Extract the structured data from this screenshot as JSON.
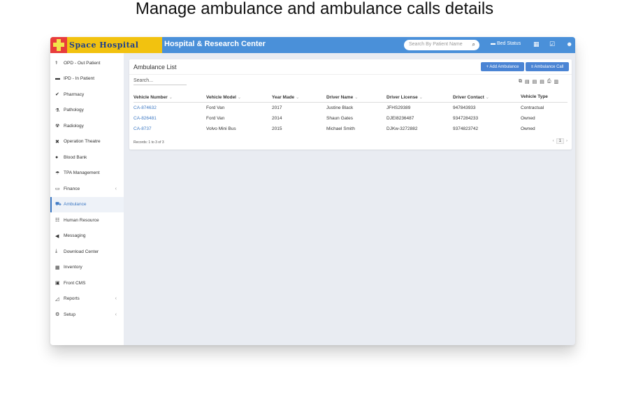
{
  "caption": "Manage ambulance and ambulance calls details",
  "header": {
    "logo_text": "Space Hospital",
    "site_title": "Hospital & Research Center",
    "search_placeholder": "Search By Patient Name",
    "bed_status": "Bed Status"
  },
  "sidebar": {
    "items": [
      {
        "label": "OPD - Out Patient",
        "icon": "stethoscope-icon"
      },
      {
        "label": "IPD - In Patient",
        "icon": "bed-icon"
      },
      {
        "label": "Pharmacy",
        "icon": "mortar-pestle-icon"
      },
      {
        "label": "Pathology",
        "icon": "flask-icon"
      },
      {
        "label": "Radiology",
        "icon": "xray-icon"
      },
      {
        "label": "Operation Theatre",
        "icon": "scissors-icon"
      },
      {
        "label": "Blood Bank",
        "icon": "droplet-icon"
      },
      {
        "label": "TPA Management",
        "icon": "umbrella-icon"
      },
      {
        "label": "Finance",
        "icon": "money-icon"
      },
      {
        "label": "Ambulance",
        "icon": "ambulance-icon"
      },
      {
        "label": "Human Resource",
        "icon": "sitemap-icon"
      },
      {
        "label": "Messaging",
        "icon": "bullhorn-icon"
      },
      {
        "label": "Download Center",
        "icon": "download-icon"
      },
      {
        "label": "Inventory",
        "icon": "inventory-icon"
      },
      {
        "label": "Front CMS",
        "icon": "cms-icon"
      },
      {
        "label": "Reports",
        "icon": "chart-icon"
      },
      {
        "label": "Setup",
        "icon": "gears-icon"
      }
    ],
    "active": "Ambulance"
  },
  "panel": {
    "title": "Ambulance List",
    "add_button": "+ Add Ambulance",
    "call_button": "≡ Ambulance Call",
    "search_placeholder": "Search...",
    "columns": [
      "Vehicle Number",
      "Vehicle Model",
      "Year Made",
      "Driver Name",
      "Driver License",
      "Driver Contact",
      "Vehicle Type"
    ],
    "rows": [
      [
        "CA-874632",
        "Ford Van",
        "2017",
        "Justine Black",
        "JFHS29389",
        "947843933",
        "Contractual"
      ],
      [
        "CA-826481",
        "Ford Van",
        "2014",
        "Shaun Gates",
        "DJEI8236487",
        "9347284233",
        "Owned"
      ],
      [
        "CA-8737",
        "Volvo Mini Bus",
        "2015",
        "Michael Smith",
        "DJKw-3272882",
        "9374823742",
        "Owned"
      ]
    ],
    "records": "Records: 1 to 3 of 3",
    "page": "1",
    "prev": "‹",
    "next": "›"
  },
  "colors": {
    "topbar": "#4a90d9",
    "accent": "#3c78c3",
    "logo_bg": "#f2c20f"
  }
}
